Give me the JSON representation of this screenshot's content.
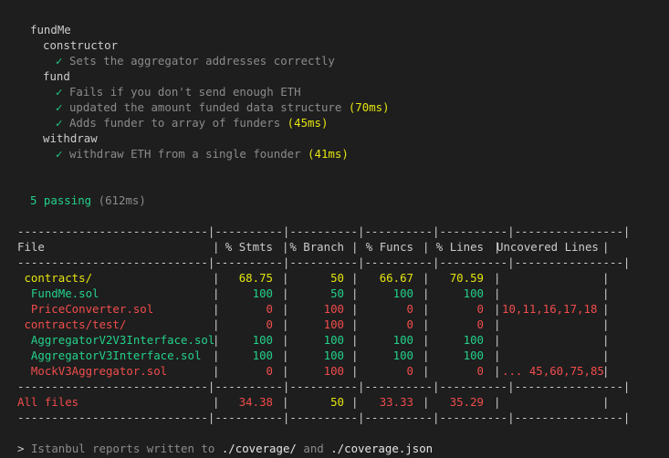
{
  "suites": {
    "root": "fundMe",
    "constructor": {
      "name": "constructor",
      "tests": [
        {
          "text": "Sets the aggregator addresses correctly",
          "time": ""
        }
      ]
    },
    "fund": {
      "name": "fund",
      "tests": [
        {
          "text": "Fails if you don't send enough ETH",
          "time": ""
        },
        {
          "text": "updated the amount funded data structure",
          "time": "(70ms)"
        },
        {
          "text": "Adds funder to array of funders",
          "time": "(45ms)"
        }
      ]
    },
    "withdraw": {
      "name": "withdraw",
      "tests": [
        {
          "text": "withdraw ETH from a single founder",
          "time": "(41ms)"
        }
      ]
    }
  },
  "summary": {
    "passing": "5 passing",
    "duration": "(612ms)"
  },
  "coverage": {
    "separator": "----------------------------|----------|----------|----------|----------|----------------|",
    "headers": {
      "file": "File",
      "stmts": "% Stmts",
      "branch": "% Branch",
      "funcs": "% Funcs",
      "lines": "% Lines",
      "uncovered": "Uncovered Lines"
    },
    "rows": [
      {
        "file": " contracts/",
        "stmts": "68.75",
        "branch": "50",
        "funcs": "66.67",
        "lines": "70.59",
        "uncovered": "",
        "color": "yellow"
      },
      {
        "file": "  FundMe.sol",
        "stmts": "100",
        "branch": "50",
        "funcs": "100",
        "lines": "100",
        "uncovered": "",
        "color": "green"
      },
      {
        "file": "  PriceConverter.sol",
        "stmts": "0",
        "branch": "100",
        "funcs": "0",
        "lines": "0",
        "uncovered": "10,11,16,17,18",
        "color": "red"
      },
      {
        "file": " contracts/test/",
        "stmts": "0",
        "branch": "100",
        "funcs": "0",
        "lines": "0",
        "uncovered": "",
        "color": "red"
      },
      {
        "file": "  AggregatorV2V3Interface.sol",
        "stmts": "100",
        "branch": "100",
        "funcs": "100",
        "lines": "100",
        "uncovered": "",
        "color": "green"
      },
      {
        "file": "  AggregatorV3Interface.sol",
        "stmts": "100",
        "branch": "100",
        "funcs": "100",
        "lines": "100",
        "uncovered": "",
        "color": "green"
      },
      {
        "file": "  MockV3Aggregator.sol",
        "stmts": "0",
        "branch": "100",
        "funcs": "0",
        "lines": "0",
        "uncovered": "... 45,60,75,85",
        "color": "red"
      }
    ],
    "total": {
      "file": "All files",
      "stmts": "34.38",
      "branch": "50",
      "funcs": "33.33",
      "lines": "35.29",
      "uncovered": ""
    }
  },
  "footer": {
    "prompt": ">",
    "text_before": "Istanbul reports written to",
    "path1": "./coverage/",
    "and": "and",
    "path2": "./coverage.json"
  },
  "colors": {
    "background": "#1e1e1e",
    "check": "#23d18b",
    "yellow": "#e5e510",
    "green": "#23d18b",
    "red": "#f14c4c",
    "gray": "#8b8b8b"
  }
}
